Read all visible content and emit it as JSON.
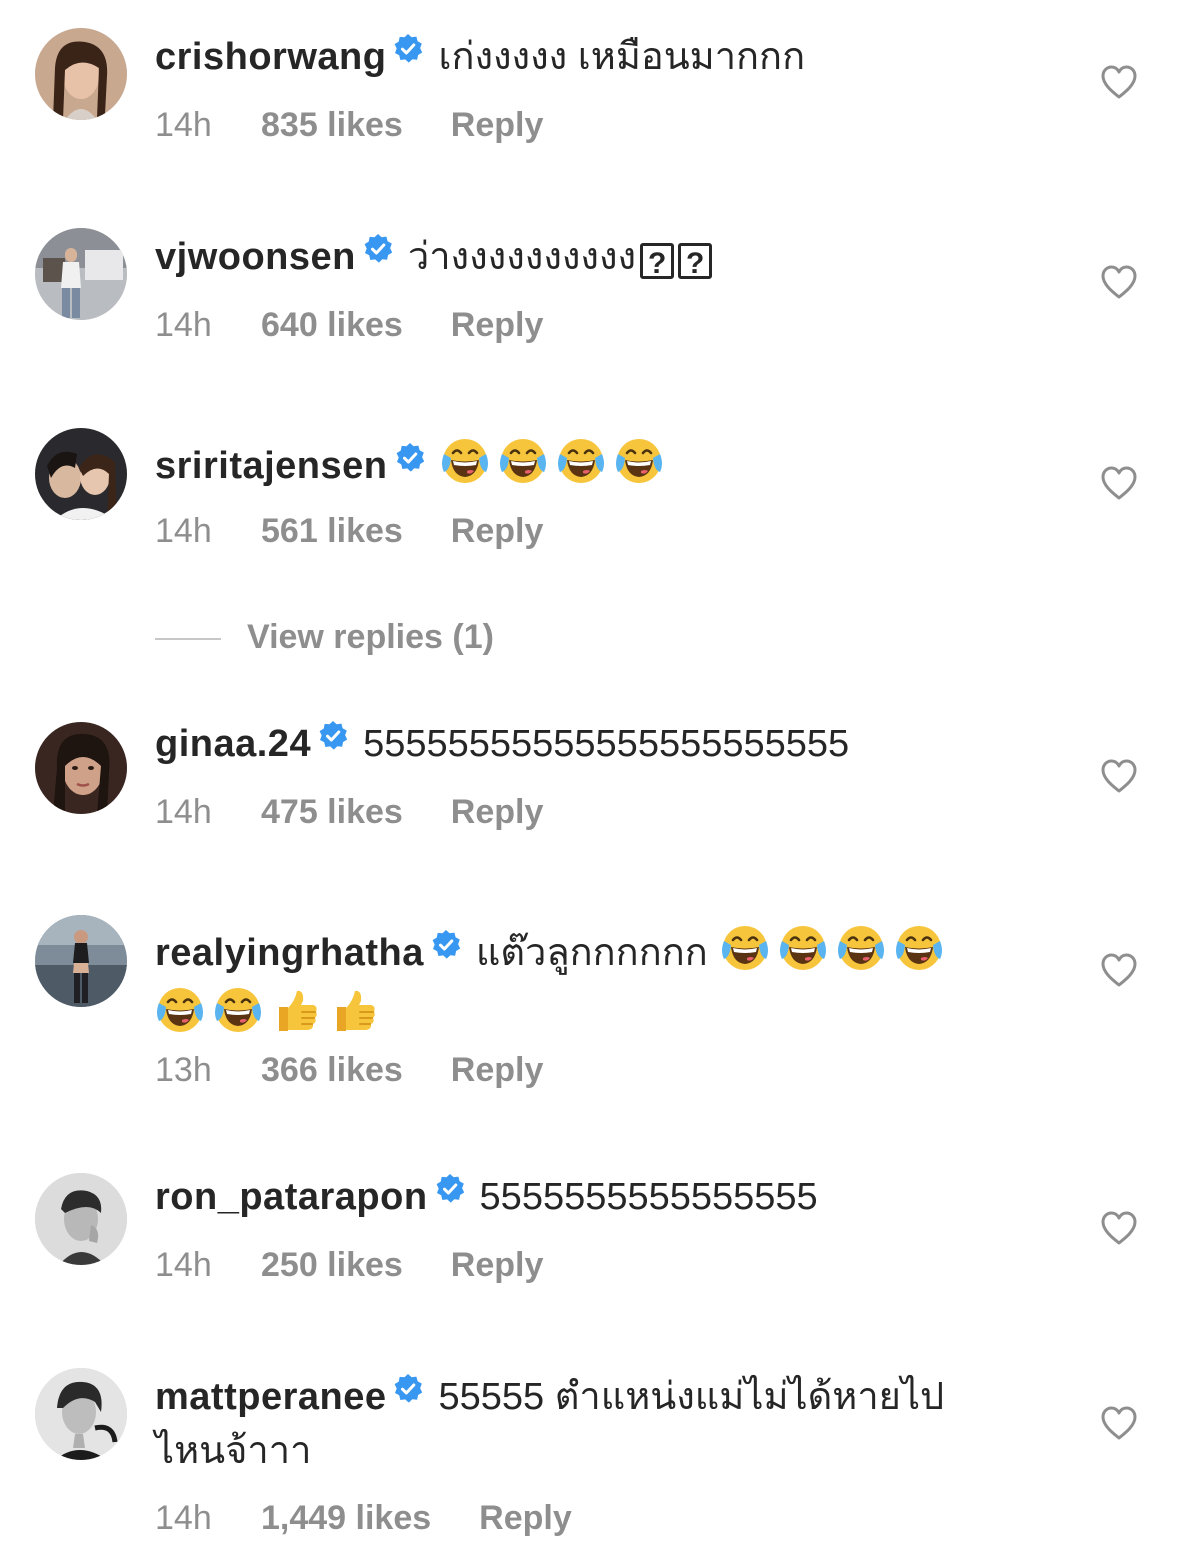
{
  "colors": {
    "text": "#262626",
    "meta": "#8e8e8e",
    "verified": "#3897f0",
    "heart_stroke": "#8e8e8e"
  },
  "icons": {
    "verified": "verified-badge-icon",
    "like": "heart-outline-icon",
    "laugh": "face-with-tears-of-joy-emoji",
    "thumbs": "thumbs-up-emoji"
  },
  "comments": [
    {
      "username": "crishorwang",
      "text": "เก่งงงงง เหมือนมากกก",
      "time": "14h",
      "likes": "835 likes",
      "reply": "Reply"
    },
    {
      "username": "vjwoonsen",
      "text": "ว่างงงงงงงงงง",
      "trailing_glyphs": [
        "?",
        "?"
      ],
      "time": "14h",
      "likes": "640 likes",
      "reply": "Reply"
    },
    {
      "username": "sriritajensen",
      "emojis": [
        "face-with-tears-of-joy-emoji",
        "face-with-tears-of-joy-emoji",
        "face-with-tears-of-joy-emoji",
        "face-with-tears-of-joy-emoji"
      ],
      "time": "14h",
      "likes": "561 likes",
      "reply": "Reply",
      "view_replies": "View replies (1)"
    },
    {
      "username": "ginaa.24",
      "text": "55555555555555555555555",
      "time": "14h",
      "likes": "475 likes",
      "reply": "Reply"
    },
    {
      "username": "realyingrhatha",
      "text": "แต๊วลูกกกกกก",
      "emojis": [
        "face-with-tears-of-joy-emoji",
        "face-with-tears-of-joy-emoji",
        "face-with-tears-of-joy-emoji",
        "face-with-tears-of-joy-emoji",
        "face-with-tears-of-joy-emoji",
        "face-with-tears-of-joy-emoji",
        "thumbs-up-emoji",
        "thumbs-up-emoji"
      ],
      "time": "13h",
      "likes": "366 likes",
      "reply": "Reply"
    },
    {
      "username": "ron_patarapon",
      "text": "5555555555555555",
      "time": "14h",
      "likes": "250 likes",
      "reply": "Reply"
    },
    {
      "username": "mattperanee",
      "text": "55555 ตำแหน่งแม่ไม่ได้หายไป ไหนจ้าาา",
      "time": "14h",
      "likes": "1,449 likes",
      "reply": "Reply"
    }
  ]
}
